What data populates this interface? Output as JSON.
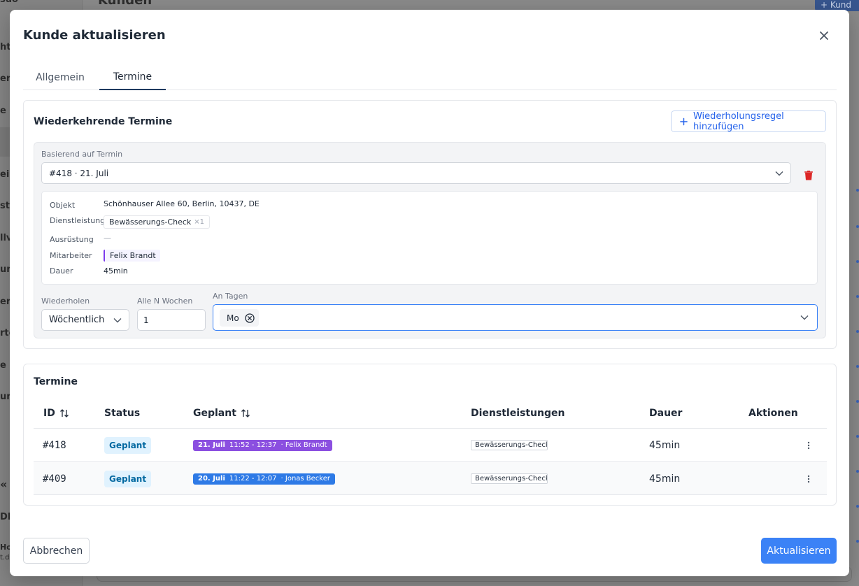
{
  "background": {
    "sidebar_fragments": [
      "sdo",
      "ht",
      "er",
      "e",
      "ei",
      "ste",
      "llv",
      "un",
      "er",
      "rte",
      "e",
      "un",
      "DE",
      "Ho",
      "t.de"
    ],
    "top_button_label": "Kund",
    "page_title_fragment": "Kunden"
  },
  "modal": {
    "title": "Kunde aktualisieren",
    "tabs": [
      {
        "label": "Allgemein"
      },
      {
        "label": "Termine"
      }
    ]
  },
  "recurring": {
    "title": "Wiederkehrende Termine",
    "add_rule_label": "Wiederholungsregel hinzufügen",
    "based_on_label": "Basierend auf Termin",
    "based_on_value": "#418 · 21. Juli",
    "details": {
      "objekt_label": "Objekt",
      "objekt_value": "Schönhauser Allee 60, Berlin, 10437, DE",
      "dienstleistungen_label": "Dienstleistungen",
      "service_name": "Bewässerungs-Check",
      "service_qty": "×1",
      "ausruestung_label": "Ausrüstung",
      "ausruestung_value": "—",
      "mitarbeiter_label": "Mitarbeiter",
      "mitarbeiter_value": "Felix Brandt",
      "dauer_label": "Dauer",
      "dauer_value": "45min"
    },
    "repeat_label": "Wiederholen",
    "repeat_value": "Wöchentlich",
    "every_n_label": "Alle N Wochen",
    "every_n_value": "1",
    "days_label": "An Tagen",
    "days_selected": [
      "Mo"
    ]
  },
  "appointments": {
    "title": "Termine",
    "columns": [
      "ID",
      "Status",
      "Geplant",
      "Dienstleistungen",
      "Dauer",
      "Aktionen"
    ],
    "rows": [
      {
        "id": "#418",
        "status": "Geplant",
        "date": "21. Juli",
        "time": "11:52 - 12:37",
        "employee": "· Felix Brandt",
        "service": "Bewässerungs-Check",
        "duration": "45min",
        "color": "#8b4fe0"
      },
      {
        "id": "#409",
        "status": "Geplant",
        "date": "20. Juli",
        "time": "11:22 - 12:07",
        "employee": "· Jonas Becker",
        "service": "Bewässerungs-Check",
        "duration": "45min",
        "color": "#2e7ae6"
      }
    ]
  },
  "footer": {
    "cancel_label": "Abbrechen",
    "update_label": "Aktualisieren"
  },
  "colors": {
    "primary": "#3b82f6",
    "danger": "#dc2626",
    "status_bg": "#e0f2fe",
    "status_text": "#0369a1"
  }
}
